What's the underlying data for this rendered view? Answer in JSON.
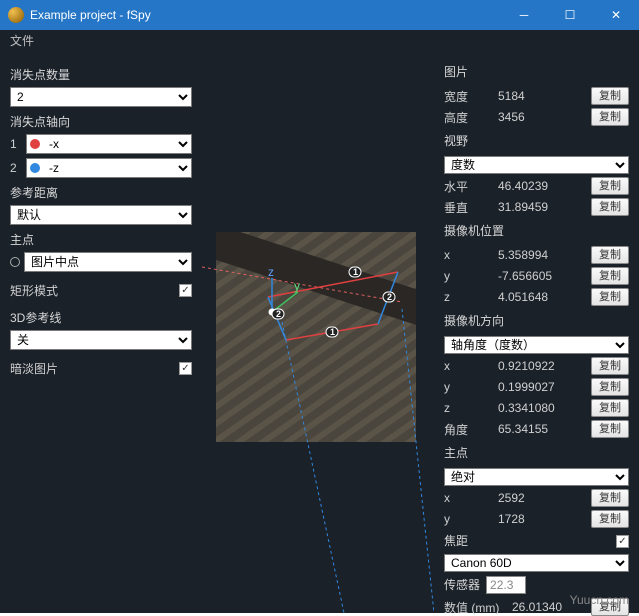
{
  "window": {
    "title": "Example project - fSpy"
  },
  "menu": {
    "file": "文件"
  },
  "left": {
    "vpCount": {
      "label": "消失点数量",
      "value": "2"
    },
    "vpAxis": {
      "label": "消失点轴向",
      "row1": {
        "idx": "1",
        "value": "-x"
      },
      "row2": {
        "idx": "2",
        "value": "-z"
      }
    },
    "refDist": {
      "label": "参考距离",
      "value": "默认"
    },
    "pp": {
      "label": "主点",
      "value": "图片中点"
    },
    "rectMode": {
      "label": "矩形模式",
      "checked": "✓"
    },
    "ref3d": {
      "label": "3D参考线",
      "value": "关"
    },
    "dim": {
      "label": "暗淡图片",
      "checked": "✓"
    }
  },
  "right": {
    "copy": "复制",
    "image": {
      "label": "图片",
      "width": {
        "k": "宽度",
        "v": "5184"
      },
      "height": {
        "k": "高度",
        "v": "3456"
      }
    },
    "fov": {
      "label": "视野",
      "mode": "度数",
      "h": {
        "k": "水平",
        "v": "46.40239"
      },
      "v": {
        "k": "垂直",
        "v": "31.89459"
      }
    },
    "camPos": {
      "label": "摄像机位置",
      "x": {
        "k": "x",
        "v": "5.358994"
      },
      "y": {
        "k": "y",
        "v": "-7.656605"
      },
      "z": {
        "k": "z",
        "v": "4.051648"
      }
    },
    "camOri": {
      "label": "摄像机方向",
      "mode": "轴角度（度数）",
      "x": {
        "k": "x",
        "v": "0.9210922"
      },
      "y": {
        "k": "y",
        "v": "0.1999027"
      },
      "z": {
        "k": "z",
        "v": "0.3341080"
      },
      "ang": {
        "k": "角度",
        "v": "65.34155"
      }
    },
    "pp": {
      "label": "主点",
      "mode": "绝对",
      "x": {
        "k": "x",
        "v": "2592"
      },
      "y": {
        "k": "y",
        "v": "1728"
      }
    },
    "focal": {
      "label": "焦距",
      "check": "✓",
      "preset": "Canon 60D"
    },
    "sensor": {
      "label": "传感器",
      "hint": "22.3",
      "val": {
        "k": "数值 (mm)",
        "v": "26.01340"
      }
    }
  },
  "watermark": "Yuucn.com"
}
